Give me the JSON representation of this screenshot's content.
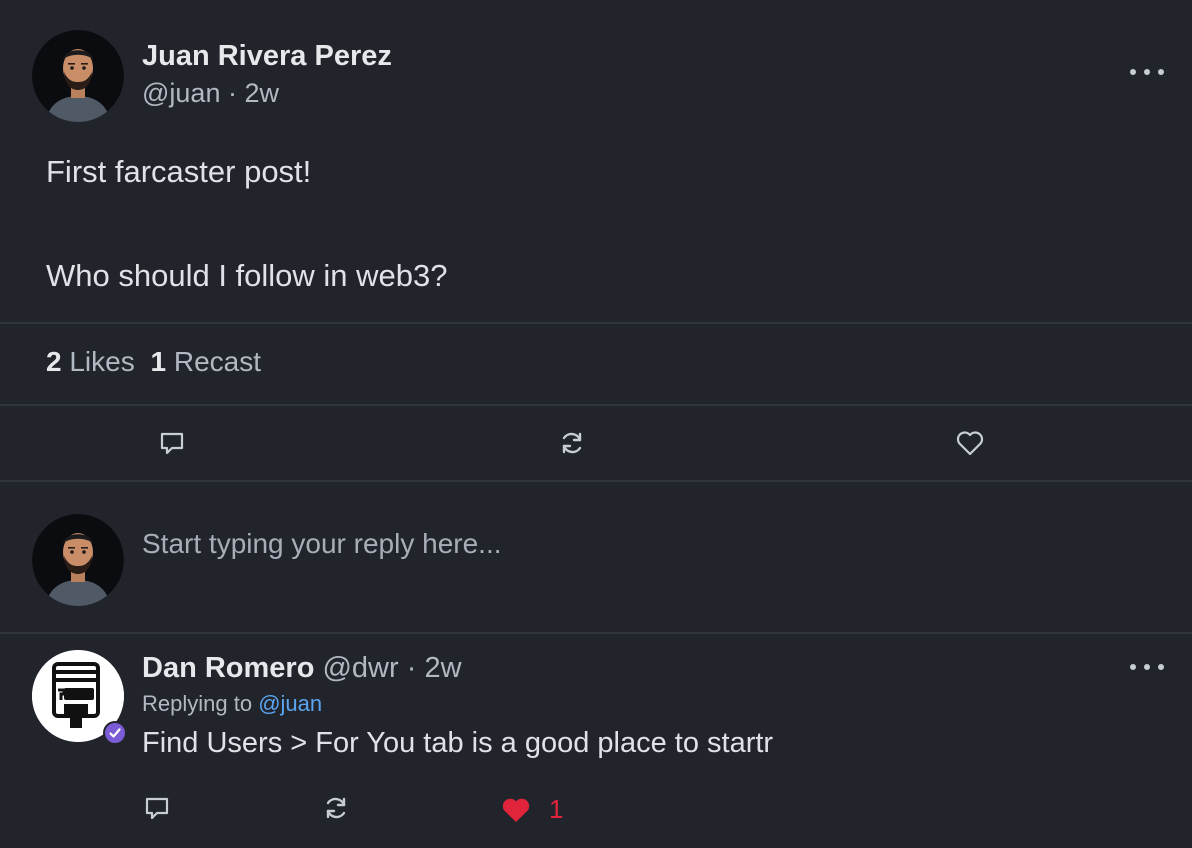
{
  "post": {
    "author_name": "Juan Rivera Perez",
    "handle": "@juan",
    "separator": "·",
    "time": "2w",
    "text_line1": "First farcaster post!",
    "text_line2": "Who should I follow in web3?",
    "likes_count": "2",
    "likes_label": "Likes",
    "recast_count": "1",
    "recast_label": "Recast"
  },
  "reply_box": {
    "placeholder": "Start typing your reply here..."
  },
  "reply": {
    "author_name": "Dan Romero",
    "handle": "@dwr",
    "separator": "·",
    "time": "2w",
    "replying_prefix": "Replying to",
    "replying_to": "@juan",
    "text": "Find Users > For You tab is a good place to startr",
    "like_count": "1"
  },
  "colors": {
    "background": "#21242b",
    "divider": "#30343c",
    "link": "#5aa4f0",
    "like_active": "#e0243b",
    "verified_badge": "#7c5bd6"
  },
  "icons": {
    "more": "more-horizontal-icon",
    "comment": "comment-icon",
    "recast": "recast-icon",
    "like": "heart-icon",
    "verified": "verified-badge-icon"
  }
}
